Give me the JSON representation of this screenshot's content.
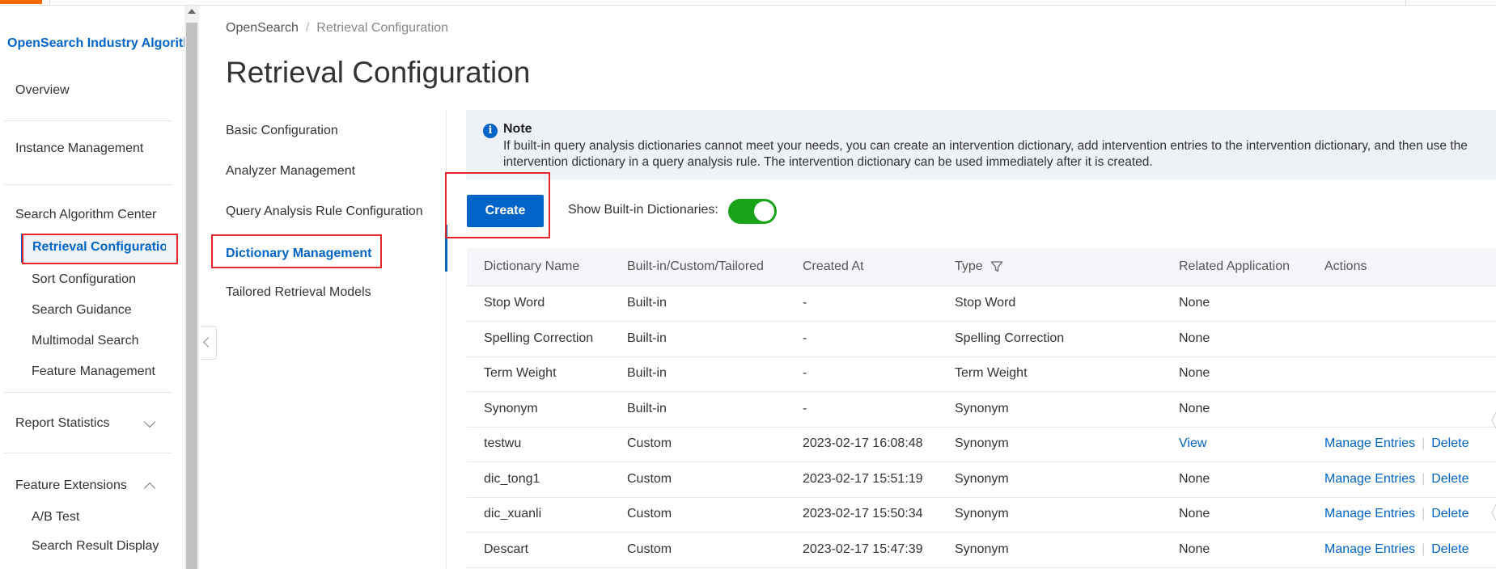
{
  "sidebar": {
    "product_title": "OpenSearch Industry Algorithm Edition",
    "overview": "Overview",
    "instance_management": "Instance Management",
    "search_algorithm_center": "Search Algorithm Center",
    "retrieval_configuration": "Retrieval Configuration",
    "sort_configuration": "Sort Configuration",
    "search_guidance": "Search Guidance",
    "multimodal_search": "Multimodal Search",
    "feature_management": "Feature Management",
    "report_statistics": "Report Statistics",
    "feature_extensions": "Feature Extensions",
    "ab_test": "A/B Test",
    "search_result_display": "Search Result Display"
  },
  "breadcrumb": {
    "home": "OpenSearch",
    "separator": "/",
    "current": "Retrieval Configuration"
  },
  "page_title": "Retrieval Configuration",
  "submenu": {
    "basic": "Basic Configuration",
    "analyzer": "Analyzer Management",
    "query_analysis": "Query Analysis Rule Configuration",
    "dictionary": "Dictionary Management",
    "tailored": "Tailored Retrieval Models"
  },
  "note": {
    "title": "Note",
    "text": "If built-in query analysis dictionaries cannot meet your needs, you can create an intervention dictionary, add intervention entries to the intervention dictionary, and then use the intervention dictionary in a query analysis rule. The intervention dictionary can be used immediately after it is created."
  },
  "create_button": "Create",
  "toggle": {
    "label": "Show Built-in Dictionaries:",
    "on": true,
    "color": "#18a31b"
  },
  "table": {
    "headers": [
      "Dictionary Name",
      "Built-in/Custom/Tailored",
      "Created At",
      "Type",
      "Related Application",
      "Actions"
    ],
    "rows": [
      {
        "name": "Stop Word",
        "kind": "Built-in",
        "created": "-",
        "type": "Stop Word",
        "app": "None",
        "manage": "",
        "delete": ""
      },
      {
        "name": "Spelling Correction",
        "kind": "Built-in",
        "created": "-",
        "type": "Spelling Correction",
        "app": "None",
        "manage": "",
        "delete": ""
      },
      {
        "name": "Term Weight",
        "kind": "Built-in",
        "created": "-",
        "type": "Term Weight",
        "app": "None",
        "manage": "",
        "delete": ""
      },
      {
        "name": "Synonym",
        "kind": "Built-in",
        "created": "-",
        "type": "Synonym",
        "app": "None",
        "manage": "",
        "delete": ""
      },
      {
        "name": "testwu",
        "kind": "Custom",
        "created": "2023-02-17 16:08:48",
        "type": "Synonym",
        "app": "View",
        "manage": "Manage Entries",
        "delete": "Delete"
      },
      {
        "name": "dic_tong1",
        "kind": "Custom",
        "created": "2023-02-17 15:51:19",
        "type": "Synonym",
        "app": "None",
        "manage": "Manage Entries",
        "delete": "Delete"
      },
      {
        "name": "dic_xuanli",
        "kind": "Custom",
        "created": "2023-02-17 15:50:34",
        "type": "Synonym",
        "app": "None",
        "manage": "Manage Entries",
        "delete": "Delete"
      },
      {
        "name": "Descart",
        "kind": "Custom",
        "created": "2023-02-17 15:47:39",
        "type": "Synonym",
        "app": "None",
        "manage": "Manage Entries",
        "delete": "Delete"
      }
    ]
  },
  "colors": {
    "accent": "#0064c8",
    "highlight_box": "#e4262b",
    "brand_orange": "#ff6a00"
  },
  "icons": {
    "info": "info-circle-icon",
    "filter": "filter-icon",
    "collapse": "chevron-left-icon"
  }
}
